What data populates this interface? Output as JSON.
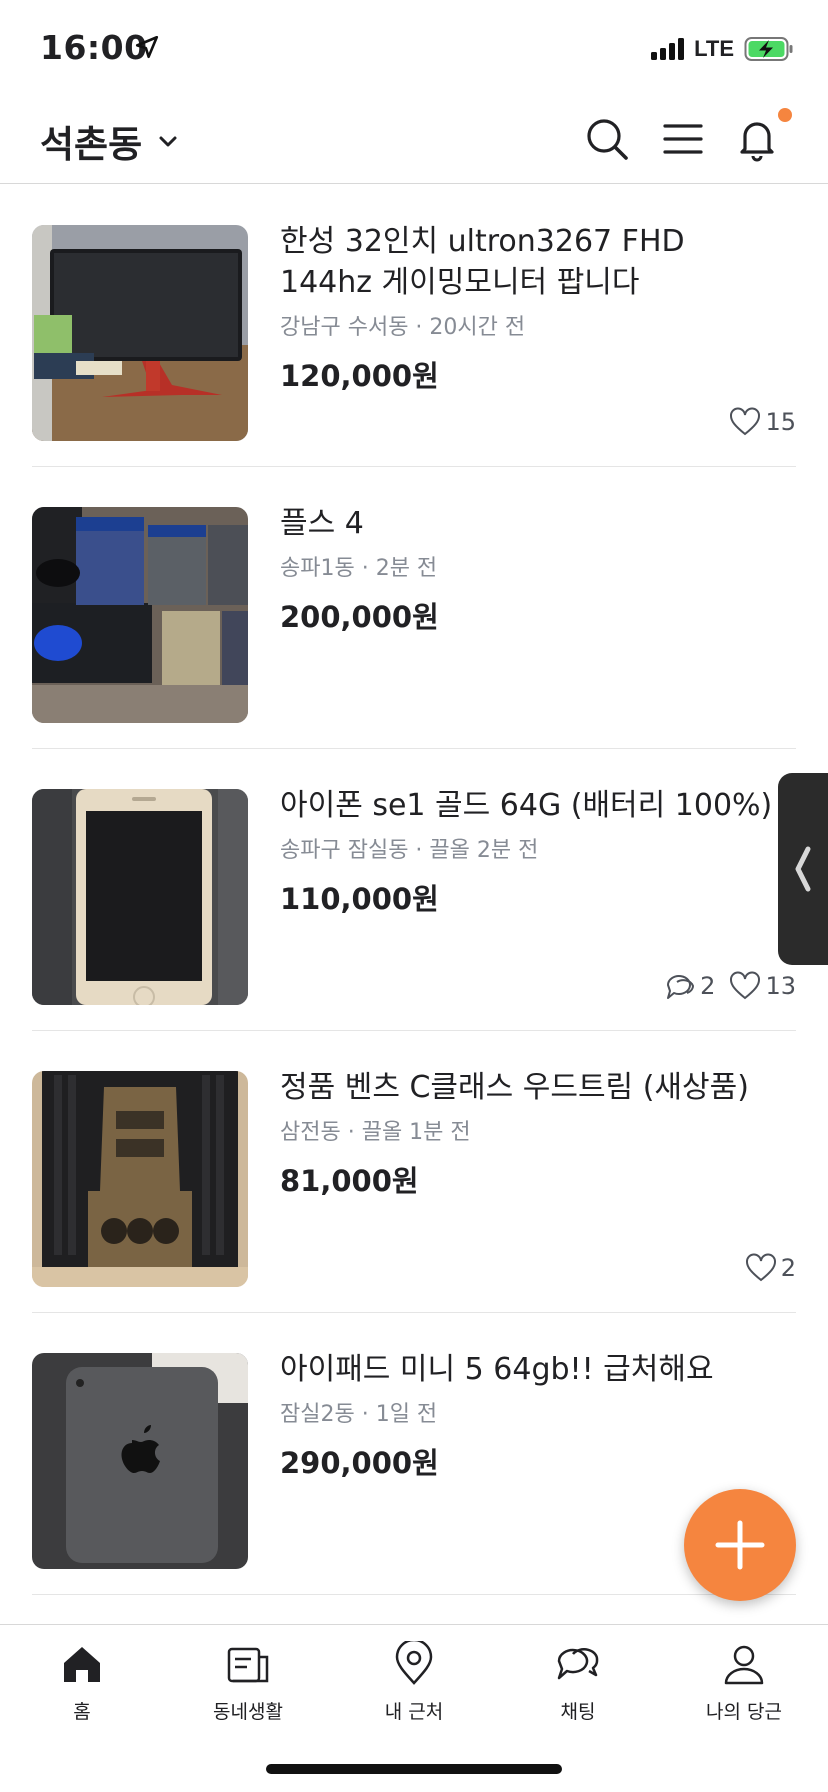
{
  "status_bar": {
    "time": "16:00",
    "network": "LTE"
  },
  "header": {
    "location": "석촌동"
  },
  "items": [
    {
      "title": "한성 32인치 ultron3267 FHD 144hz 게이밍모니터 팝니다",
      "meta": "강남구 수서동 · 20시간 전",
      "price": "120,000원",
      "chats": "",
      "likes": "15"
    },
    {
      "title": "플스 4",
      "meta": "송파1동 · 2분 전",
      "price": "200,000원",
      "chats": "",
      "likes": ""
    },
    {
      "title": "아이폰 se1 골드 64G (배터리 100%)",
      "meta": "송파구 잠실동 · 끌올 2분 전",
      "price": "110,000원",
      "chats": "2",
      "likes": "13"
    },
    {
      "title": "정품 벤츠 C클래스 우드트림 (새상품)",
      "meta": "삼전동 · 끌올 1분 전",
      "price": "81,000원",
      "chats": "",
      "likes": "2"
    },
    {
      "title": "아이패드 미니 5 64gb!! 급처해요",
      "meta": "잠실2동 · 1일 전",
      "price": "290,000원",
      "chats": "",
      "likes": ""
    }
  ],
  "bottom_nav": [
    {
      "label": "홈",
      "icon": "home-icon"
    },
    {
      "label": "동네생활",
      "icon": "community-icon"
    },
    {
      "label": "내 근처",
      "icon": "location-pin-icon"
    },
    {
      "label": "채팅",
      "icon": "chat-icon"
    },
    {
      "label": "나의 당근",
      "icon": "profile-icon"
    }
  ],
  "colors": {
    "accent": "#f5853f",
    "text": "#212124",
    "meta": "#868b94",
    "battery": "#4cd964"
  }
}
